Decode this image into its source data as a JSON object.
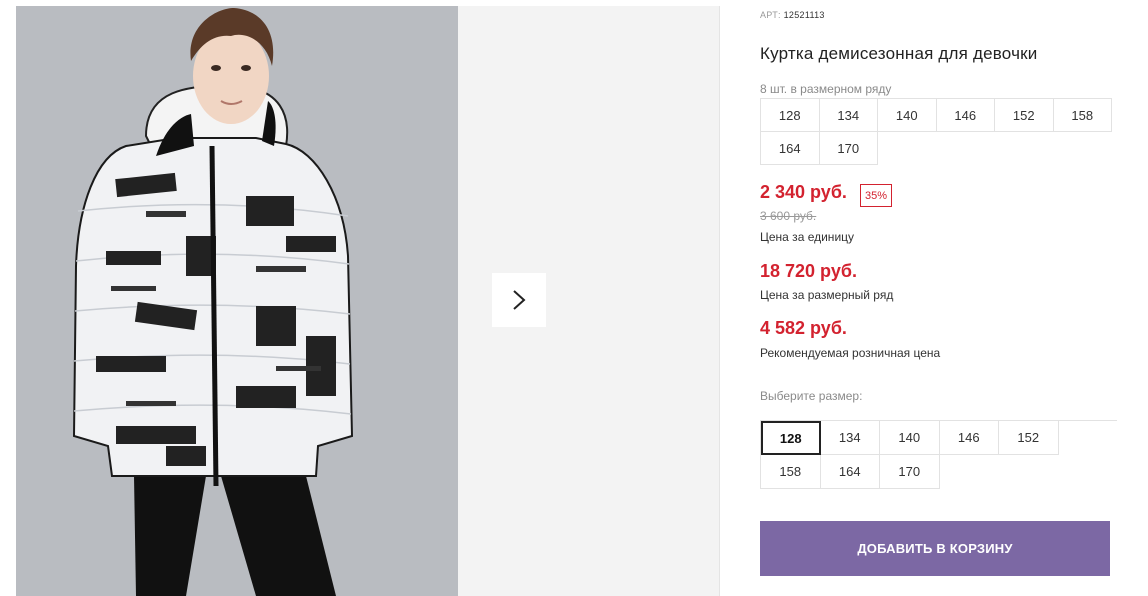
{
  "gallery": {
    "main_photo_alt": "",
    "next_icon": "chevron-right-icon"
  },
  "product": {
    "article_label": "АРТ:",
    "article_value": "12521113",
    "title": "Куртка демисезонная для девочки",
    "pack_note": "8 шт. в размерном ряду",
    "pack_sizes": [
      "128",
      "134",
      "140",
      "146",
      "152",
      "158",
      "164",
      "170"
    ]
  },
  "prices": {
    "unit_price": "2 340 руб.",
    "discount": "35%",
    "old_price": "3 600 руб.",
    "unit_label": "Цена за единицу",
    "pack_price": "18 720 руб.",
    "pack_label": "Цена за размерный ряд",
    "retail_price": "4 582 руб.",
    "retail_label": "Рекомендуемая розничная цена"
  },
  "size_select": {
    "label": "Выберите размер:",
    "sizes": [
      "128",
      "134",
      "140",
      "146",
      "152",
      "158",
      "164",
      "170"
    ],
    "selected": "128"
  },
  "cart": {
    "add_label": "ДОБАВИТЬ В КОРЗИНУ"
  },
  "colors": {
    "price_red": "#d3222f",
    "button_purple": "#7c68a4",
    "photo_bg": "#b9bcc1"
  }
}
